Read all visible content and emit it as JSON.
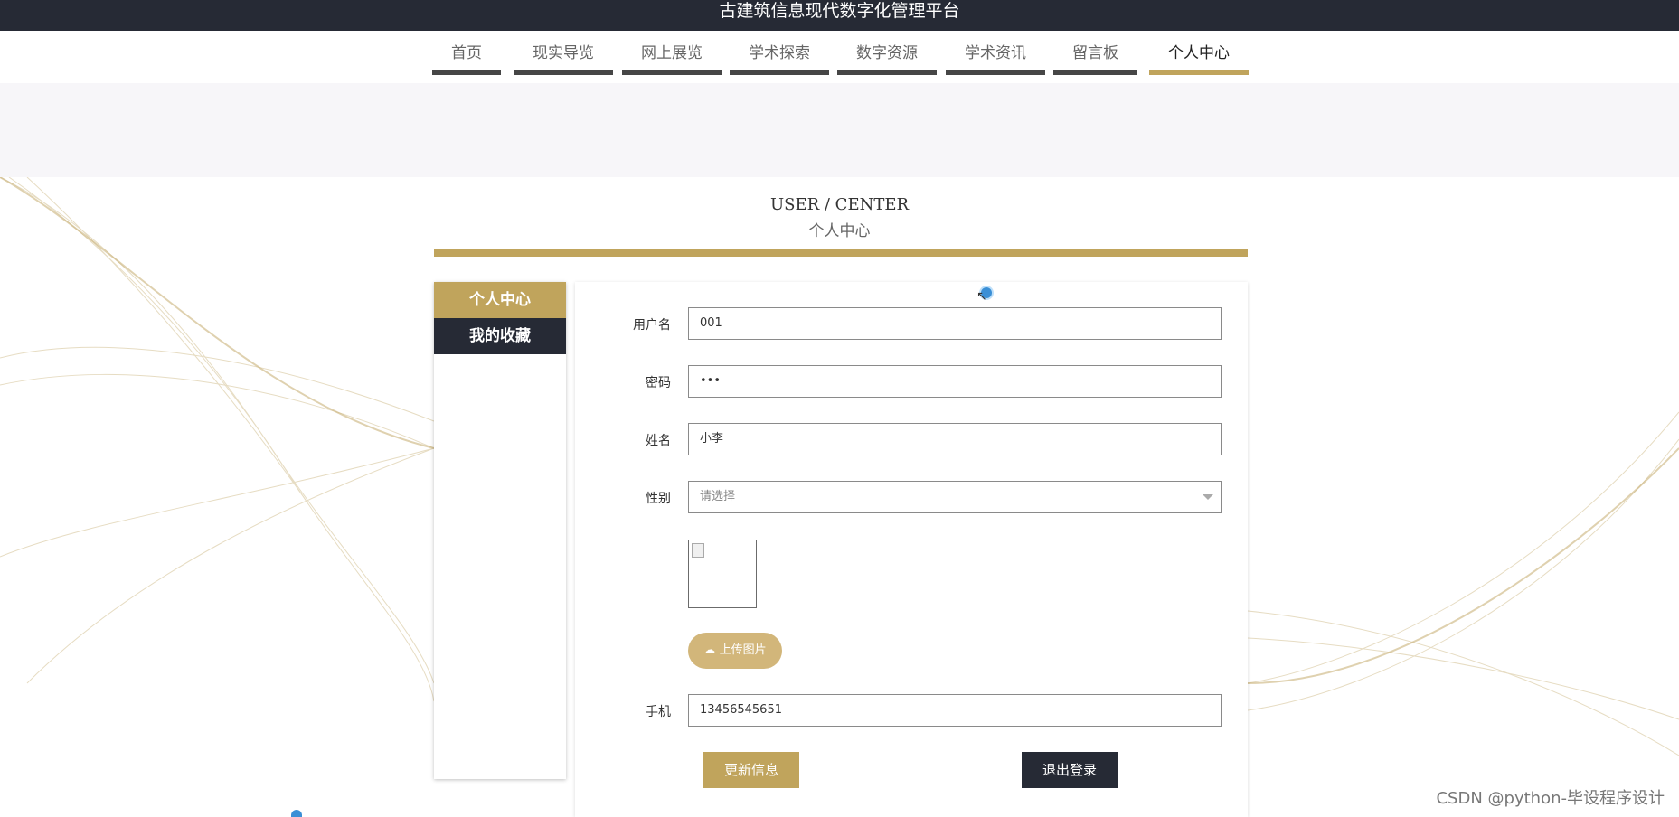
{
  "site": {
    "title": "古建筑信息现代数字化管理平台"
  },
  "nav": {
    "items": [
      {
        "label": "首页"
      },
      {
        "label": "现实导览"
      },
      {
        "label": "网上展览"
      },
      {
        "label": "学术探索"
      },
      {
        "label": "数字资源"
      },
      {
        "label": "学术资讯"
      },
      {
        "label": "留言板"
      },
      {
        "label": "个人中心"
      }
    ],
    "active": "个人中心"
  },
  "section": {
    "title_en": "USER / CENTER",
    "title_zh": "个人中心"
  },
  "sidebar": {
    "items": [
      {
        "label": "个人中心"
      },
      {
        "label": "我的收藏"
      }
    ]
  },
  "form": {
    "username": {
      "label": "用户名",
      "value": "001"
    },
    "password": {
      "label": "密码",
      "value": "•••"
    },
    "name": {
      "label": "姓名",
      "value": "小李"
    },
    "gender": {
      "label": "性别",
      "placeholder": "请选择"
    },
    "upload_label": "上传图片",
    "phone": {
      "label": "手机",
      "value": "13456545651"
    },
    "update_button": "更新信息",
    "logout_button": "退出登录"
  },
  "watermark": "CSDN @python-毕设程序设计",
  "colors": {
    "gold": "#c0a45c",
    "dark": "#262a35",
    "upload": "#d2b67a"
  }
}
